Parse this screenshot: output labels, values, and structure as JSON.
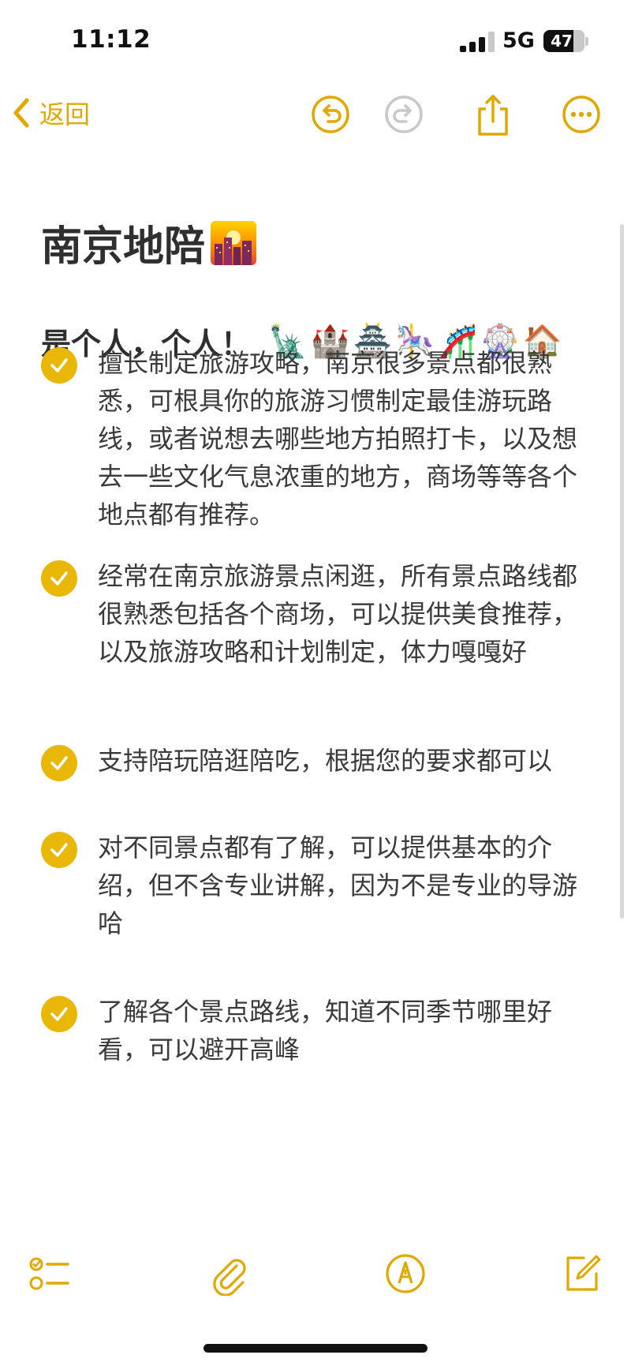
{
  "status_bar": {
    "time": "11:12",
    "network": "5G",
    "battery": "47"
  },
  "nav": {
    "back_label": "返回",
    "icons": [
      "chevron-left-icon",
      "undo-icon",
      "redo-icon",
      "share-icon",
      "more-icon"
    ],
    "accent_color": "#e0a800"
  },
  "note": {
    "title": "南京地陪",
    "title_emoji": "city-sunset-emoji",
    "subtitle": "是个人，个人！",
    "subtitle_emojis": "🗽🏰🏯🎠🎢🎡🏠",
    "items": [
      {
        "text": "擅长制定旅游攻略，南京很多景点都很熟悉，可根具你的旅游习惯制定最佳游玩路线，或者说想去哪些地方拍照打卡，以及想去一些文化气息浓重的地方，商场等等各个地点都有推荐。",
        "checked": true
      },
      {
        "text": "经常在南京旅游景点闲逛，所有景点路线都很熟悉包括各个商场，可以提供美食推荐，以及旅游攻略和计划制定，体力嘎嘎好",
        "checked": true
      },
      {
        "text": "支持陪玩陪逛陪吃，根据您的要求都可以",
        "checked": true
      },
      {
        "text": "对不同景点都有了解，可以提供基本的介绍，但不含专业讲解，因为不是专业的导游哈",
        "checked": true
      },
      {
        "text": "了解各个景点路线，知道不同季节哪里好看，可以避开高峰",
        "checked": true
      }
    ],
    "check_color": "#e9b707"
  },
  "toolbar": {
    "icons": [
      "checklist-icon",
      "paperclip-icon",
      "markup-pen-icon",
      "compose-icon"
    ]
  }
}
